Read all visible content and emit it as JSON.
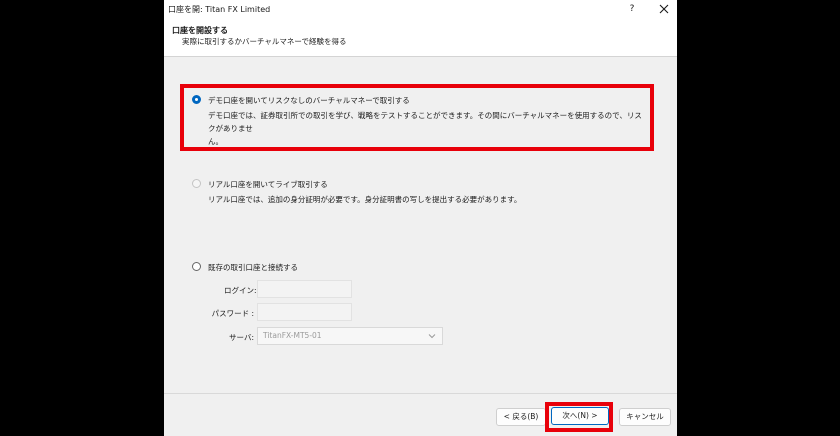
{
  "window": {
    "title": "口座を開: Titan FX Limited",
    "help_label": "?"
  },
  "header": {
    "title": "口座を開設する",
    "subtitle": "実際に取引するかバーチャルマネーで経験を得る"
  },
  "options": {
    "demo": {
      "label": "デモ口座を開いてリスクなしのバーチャルマネーで取引する",
      "desc_line1": "デモ口座では、証券取引所での取引を学び、戦略をテストすることができます。その間にバーチャルマネーを使用するので、リスクがありませ",
      "desc_line2": "ん。",
      "selected": true
    },
    "real": {
      "label": "リアル口座を開いてライブ取引する",
      "desc": "リアル口座では、追加の身分証明が必要です。身分証明書の写しを提出する必要があります。",
      "enabled": false
    },
    "existing": {
      "label": "既存の取引口座と接続する"
    }
  },
  "fields": {
    "login_label": "ログイン:",
    "login_value": "",
    "password_label": "パスワード :",
    "password_value": "",
    "server_label": "サーバ:",
    "server_value": "TitanFX-MT5-01"
  },
  "buttons": {
    "back": "< 戻る(B)",
    "next": "次へ(N) >",
    "cancel": "キャンセル"
  },
  "colors": {
    "highlight": "#e8000a",
    "accent": "#0067c0"
  }
}
